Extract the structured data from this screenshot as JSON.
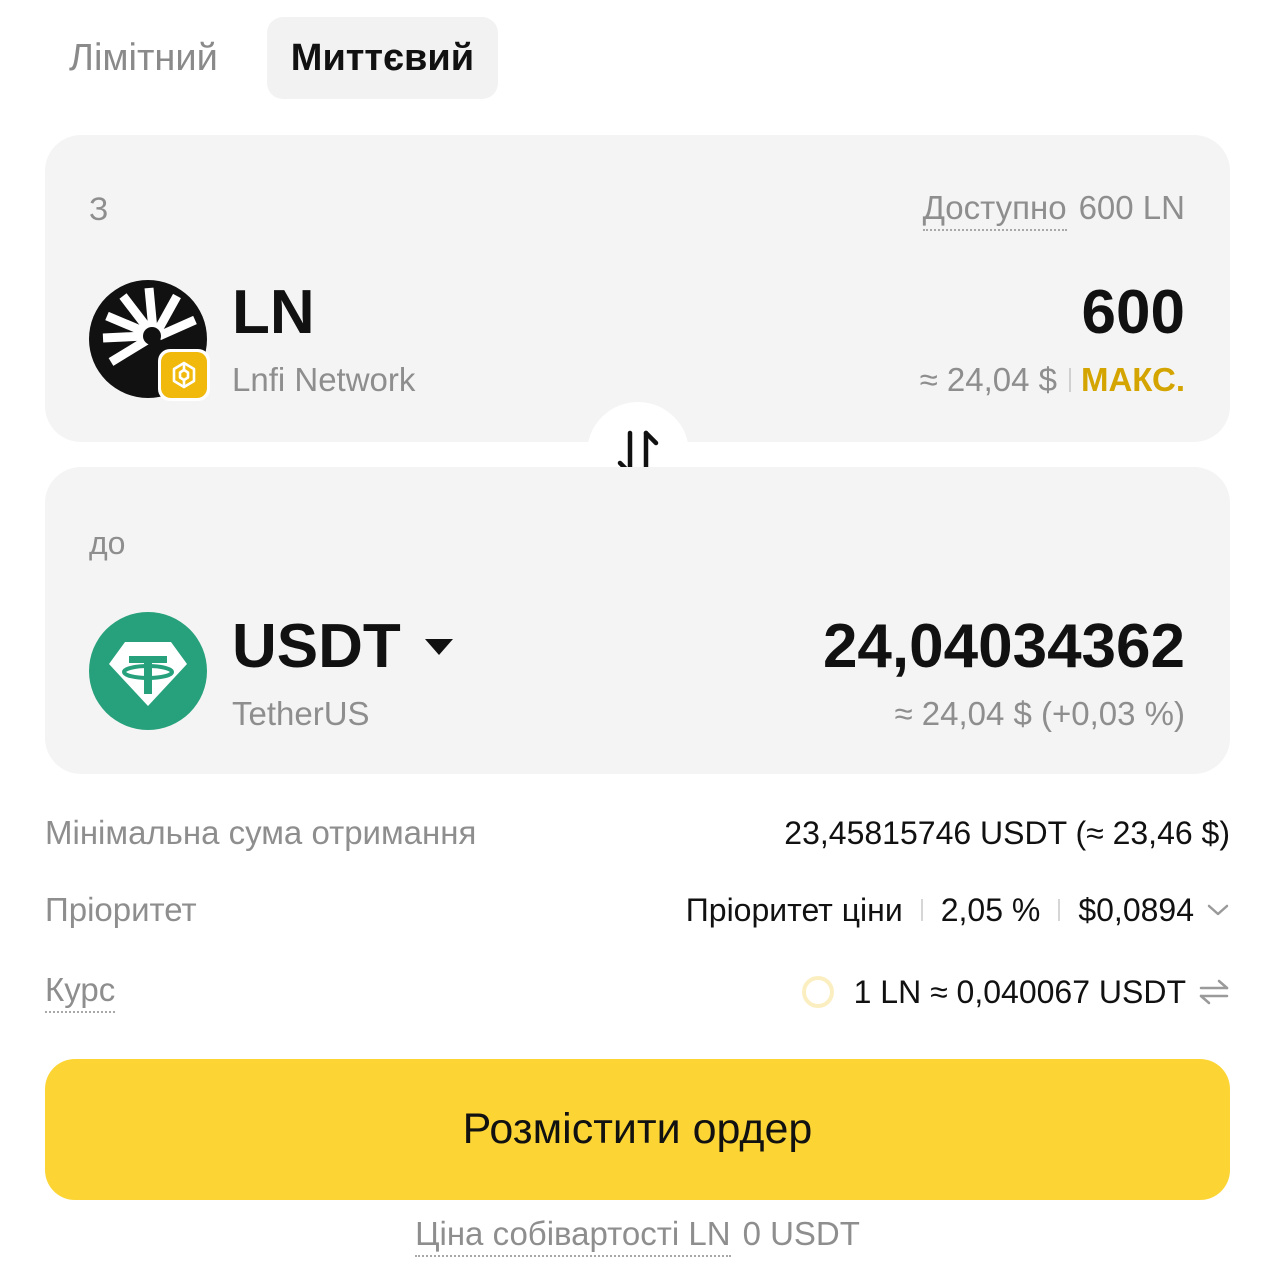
{
  "tabs": {
    "limit": "Лімітний",
    "instant": "Миттєвий"
  },
  "from": {
    "label": "З",
    "available_label": "Доступно",
    "available_value": "600 LN",
    "symbol": "LN",
    "name": "Lnfi Network",
    "amount": "600",
    "usd_value": "≈ 24,04 $",
    "max_label": "МАКС.",
    "icon": "lnfi-network-icon",
    "badge_icon": "bnb-chain-badge-icon"
  },
  "to": {
    "label": "до",
    "symbol": "USDT",
    "name": "TetherUS",
    "amount": "24,04034362",
    "usd_value": "≈ 24,04 $ (+0,03 %)",
    "icon": "tether-icon"
  },
  "details": {
    "min_receive_label": "Мінімальна сума отримання",
    "min_receive_value": "23,45815746 USDT (≈ 23,46 $)",
    "priority_label": "Пріоритет",
    "priority_mode": "Пріоритет ціни",
    "priority_percent": "2,05 %",
    "priority_fee": "$0,0894",
    "rate_label": "Курс",
    "rate_value": "1 LN ≈ 0,040067 USDT"
  },
  "order_button": "Розмістити ордер",
  "cost": {
    "label": "Ціна собівартості LN",
    "value": "0 USDT"
  },
  "colors": {
    "accent": "#fcd535",
    "max": "#d4a400",
    "tether": "#26a17b",
    "bnb": "#f0b90b",
    "card": "#f4f4f4"
  }
}
